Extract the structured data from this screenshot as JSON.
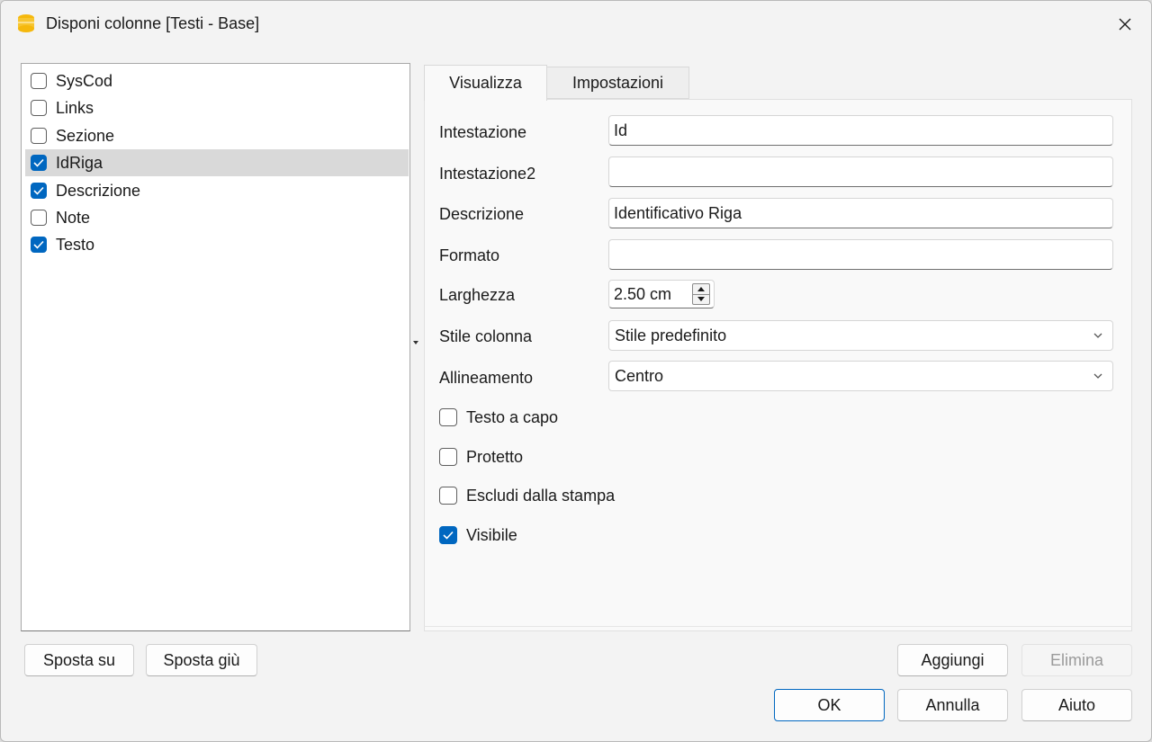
{
  "window": {
    "title": "Disponi colonne [Testi - Base]"
  },
  "columns_list": [
    {
      "label": "SysCod",
      "checked": false,
      "selected": false
    },
    {
      "label": "Links",
      "checked": false,
      "selected": false
    },
    {
      "label": "Sezione",
      "checked": false,
      "selected": false
    },
    {
      "label": "IdRiga",
      "checked": true,
      "selected": true
    },
    {
      "label": "Descrizione",
      "checked": true,
      "selected": false
    },
    {
      "label": "Note",
      "checked": false,
      "selected": false
    },
    {
      "label": "Testo",
      "checked": true,
      "selected": false
    }
  ],
  "tabs": [
    {
      "label": "Visualizza",
      "active": true
    },
    {
      "label": "Impostazioni",
      "active": false
    }
  ],
  "form": {
    "intestazione": {
      "label": "Intestazione",
      "value": "Id"
    },
    "intestazione2": {
      "label": "Intestazione2",
      "value": ""
    },
    "descrizione": {
      "label": "Descrizione",
      "value": "Identificativo Riga"
    },
    "formato": {
      "label": "Formato",
      "value": ""
    },
    "larghezza": {
      "label": "Larghezza",
      "value": "2.50 cm"
    },
    "stile_colonna": {
      "label": "Stile colonna",
      "value": "Stile predefinito"
    },
    "allineamento": {
      "label": "Allineamento",
      "value": "Centro"
    }
  },
  "options": [
    {
      "label": "Testo a capo",
      "checked": false
    },
    {
      "label": "Protetto",
      "checked": false
    },
    {
      "label": "Escludi dalla stampa",
      "checked": false
    },
    {
      "label": "Visibile",
      "checked": true
    }
  ],
  "buttons": {
    "move_up": "Sposta su",
    "move_down": "Sposta giù",
    "add": "Aggiungi",
    "delete": "Elimina",
    "ok": "OK",
    "cancel": "Annulla",
    "help": "Aiuto"
  },
  "colors": {
    "accent": "#0067c0",
    "selected_row": "#d9d9d9",
    "app_icon": "#f5b80c"
  }
}
